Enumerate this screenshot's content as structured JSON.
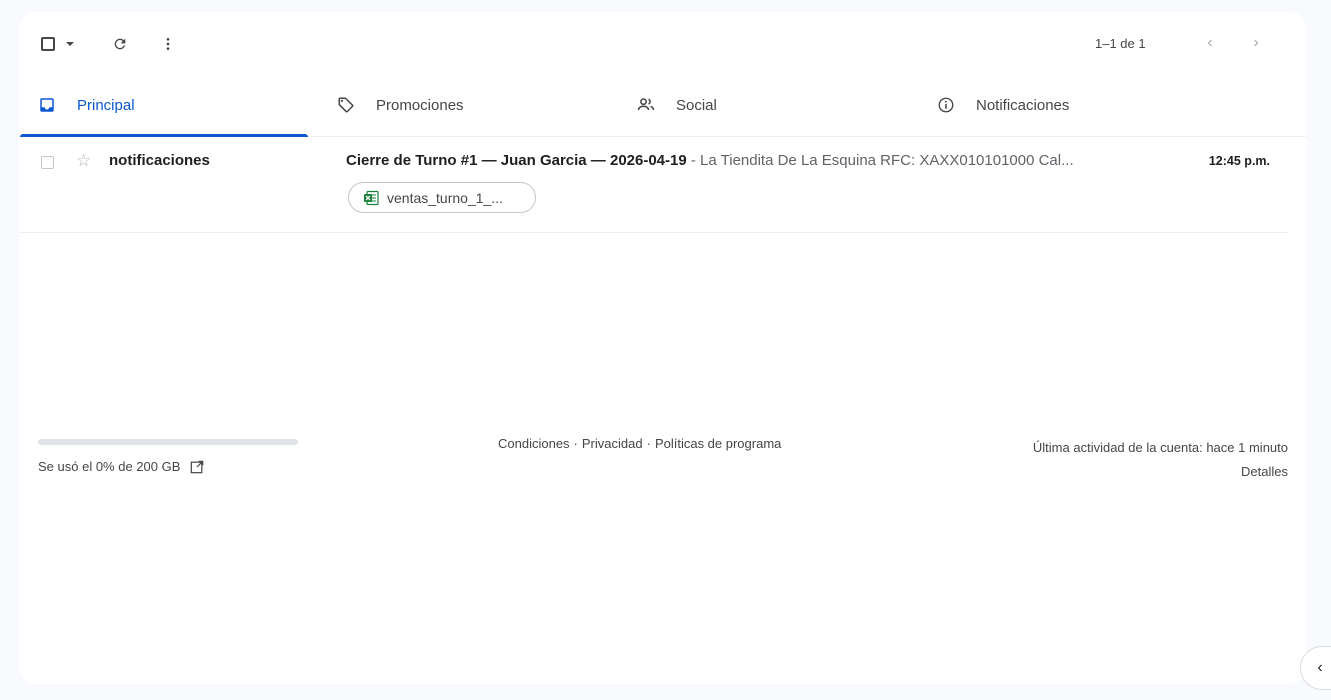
{
  "toolbar": {
    "select_icon": "checkbox-icon",
    "dropdown_icon": "caret-down-icon",
    "refresh_icon": "refresh-icon",
    "more_icon": "more-vert-icon",
    "pagination": "1–1 de 1",
    "prev_icon": "chevron-left-icon",
    "next_icon": "chevron-right-icon"
  },
  "tabs": [
    {
      "label": "Principal",
      "icon": "inbox-icon",
      "active": true
    },
    {
      "label": "Promociones",
      "icon": "tag-icon",
      "active": false
    },
    {
      "label": "Social",
      "icon": "people-icon",
      "active": false
    },
    {
      "label": "Notificaciones",
      "icon": "info-icon",
      "active": false
    }
  ],
  "messages": [
    {
      "sender": "notificaciones",
      "subject": "Cierre de Turno #1 — Juan Garcia — 2026-04-19",
      "separator": " - ",
      "snippet": "La Tiendita De La Esquina RFC: XAXX010101000 Cal...",
      "time": "12:45 p.m.",
      "attachment": "ventas_turno_1_...",
      "attachment_icon": "excel-file-icon"
    }
  ],
  "footer": {
    "storage_used_fraction": 0.0,
    "storage_text": "Se usó el 0% de 200 GB",
    "links": [
      "Condiciones",
      "Privacidad",
      "Políticas de programa"
    ],
    "link_separator": "·",
    "activity": "Última actividad de la cuenta: hace 1 minuto",
    "details": "Detalles"
  },
  "colors": {
    "accent": "#0b57d0",
    "background": "#f8fafd",
    "excel_green": "#188038"
  }
}
